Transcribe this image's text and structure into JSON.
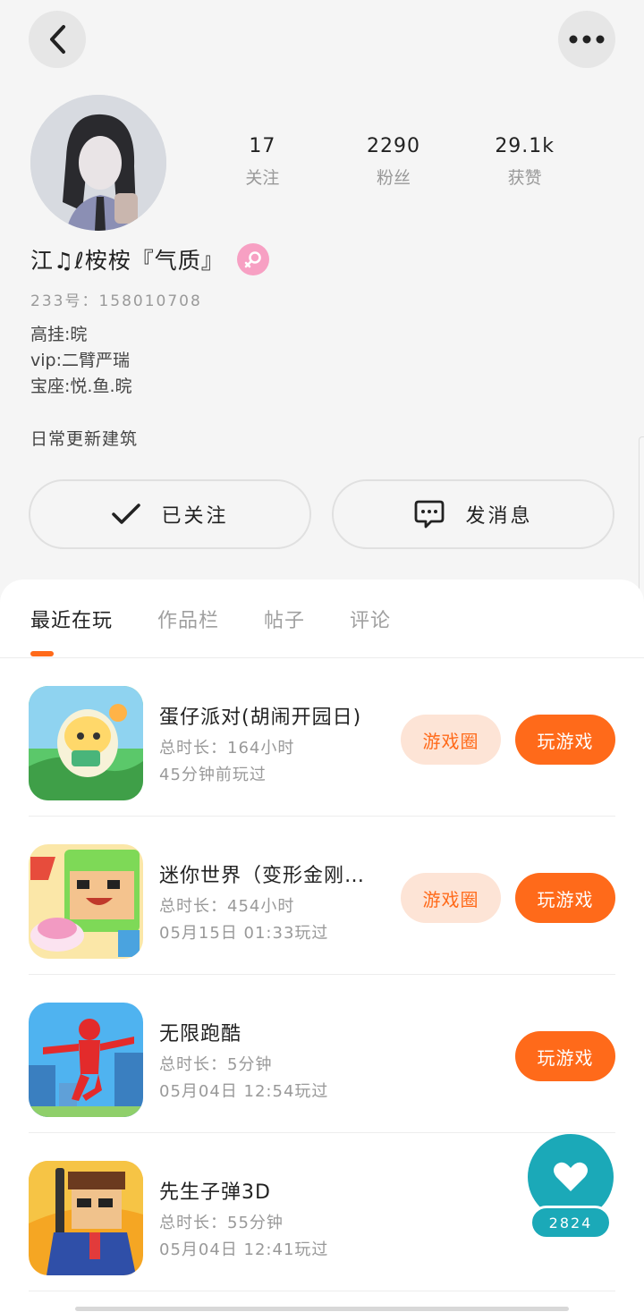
{
  "profile": {
    "nickname": "江♫ℓ桉桉『气质』",
    "uid": "233号：158010708",
    "bio_lines": [
      "高挂:晥",
      "vip:二臂严瑞",
      "宝座:悦.鱼.晥"
    ],
    "daily": "日常更新建筑",
    "stats": [
      {
        "value": "17",
        "label": "关注"
      },
      {
        "value": "2290",
        "label": "粉丝"
      },
      {
        "value": "29.1k",
        "label": "获赞"
      }
    ]
  },
  "actions": {
    "follow_label": "已关注",
    "message_label": "发消息"
  },
  "tabs": [
    "最近在玩",
    "作品栏",
    "帖子",
    "评论"
  ],
  "games": [
    {
      "name": "蛋仔派对(胡闹开园日)",
      "duration": "总时长：164小时",
      "last": "45分钟前玩过",
      "circle": "游戏圈",
      "play": "玩游戏"
    },
    {
      "name": "迷你世界（变形金刚联动）",
      "duration": "总时长：454小时",
      "last": "05月15日 01:33玩过",
      "circle": "游戏圈",
      "play": "玩游戏"
    },
    {
      "name": "无限跑酷",
      "duration": "总时长：5分钟",
      "last": "05月04日 12:54玩过",
      "circle": null,
      "play": "玩游戏"
    },
    {
      "name": "先生子弹3D",
      "duration": "总时长：55分钟",
      "last": "05月04日 12:41玩过",
      "circle": null,
      "play": null
    }
  ],
  "like_float": {
    "count": "2824"
  },
  "colors": {
    "accent": "#ff6a1a",
    "accent_light": "#fde4d6",
    "teal": "#1ba9b8",
    "gender_pink": "#f7a0c3"
  }
}
